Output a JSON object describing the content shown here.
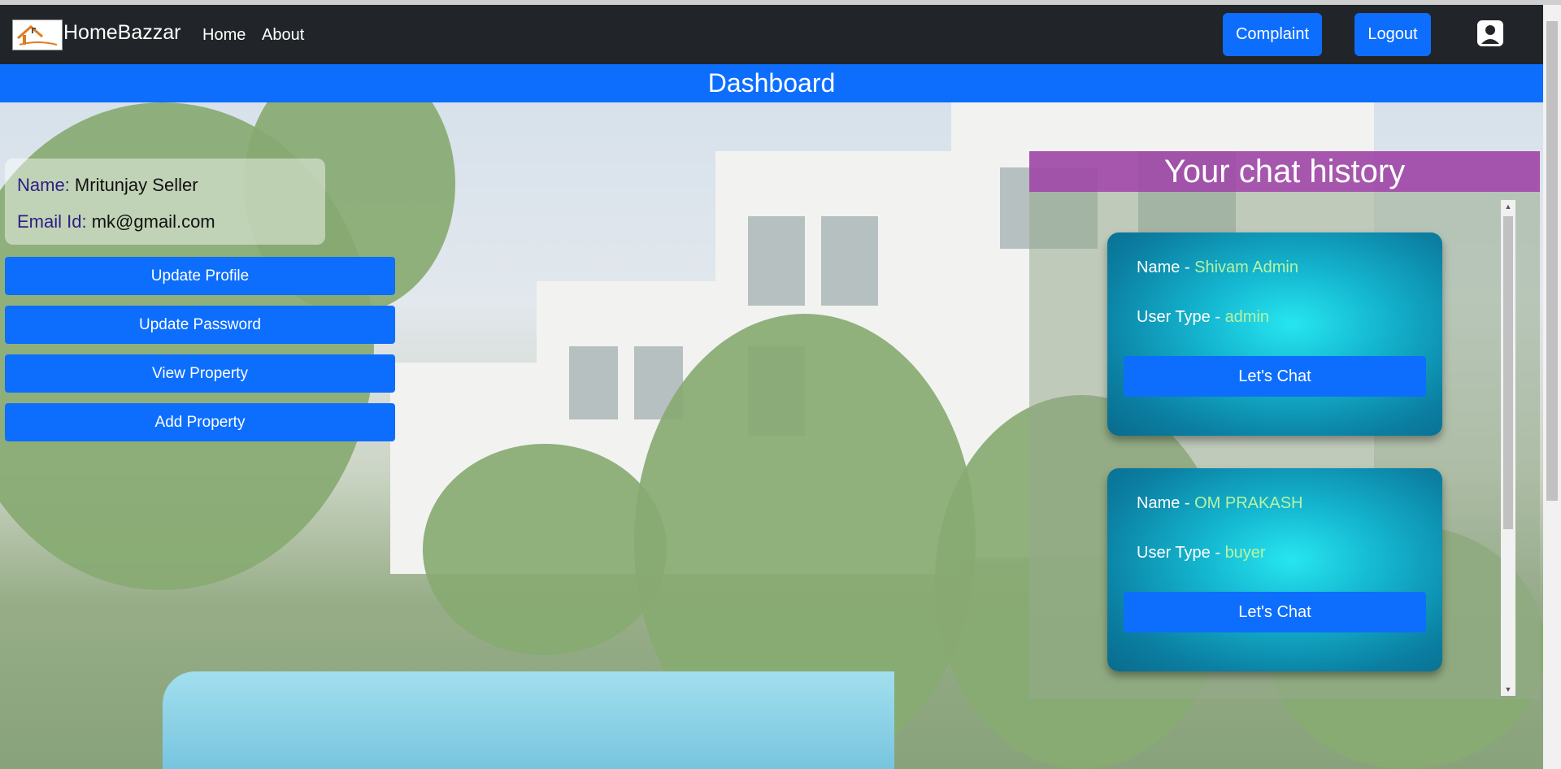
{
  "navbar": {
    "brand": "HomeBazzar",
    "links": [
      "Home",
      "About"
    ],
    "complaint_label": "Complaint",
    "logout_label": "Logout"
  },
  "dashboard_title": "Dashboard",
  "user": {
    "name_key": "Name:",
    "name": "Mritunjay Seller",
    "email_key": "Email Id:",
    "email": "mk@gmail.com"
  },
  "actions": [
    "Update Profile",
    "Update Password",
    "View Property",
    "Add Property"
  ],
  "chat": {
    "title": "Your chat history",
    "name_label": "Name - ",
    "type_label": "User Type - ",
    "button_label": "Let's Chat",
    "entries": [
      {
        "name": "Shivam Admin",
        "type": "admin"
      },
      {
        "name": "OM PRAKASH",
        "type": "buyer"
      }
    ]
  },
  "colors": {
    "primary": "#0d6efd",
    "navbar": "#212529",
    "chat_header": "#a03caa",
    "chat_card": "#14b5cf"
  }
}
